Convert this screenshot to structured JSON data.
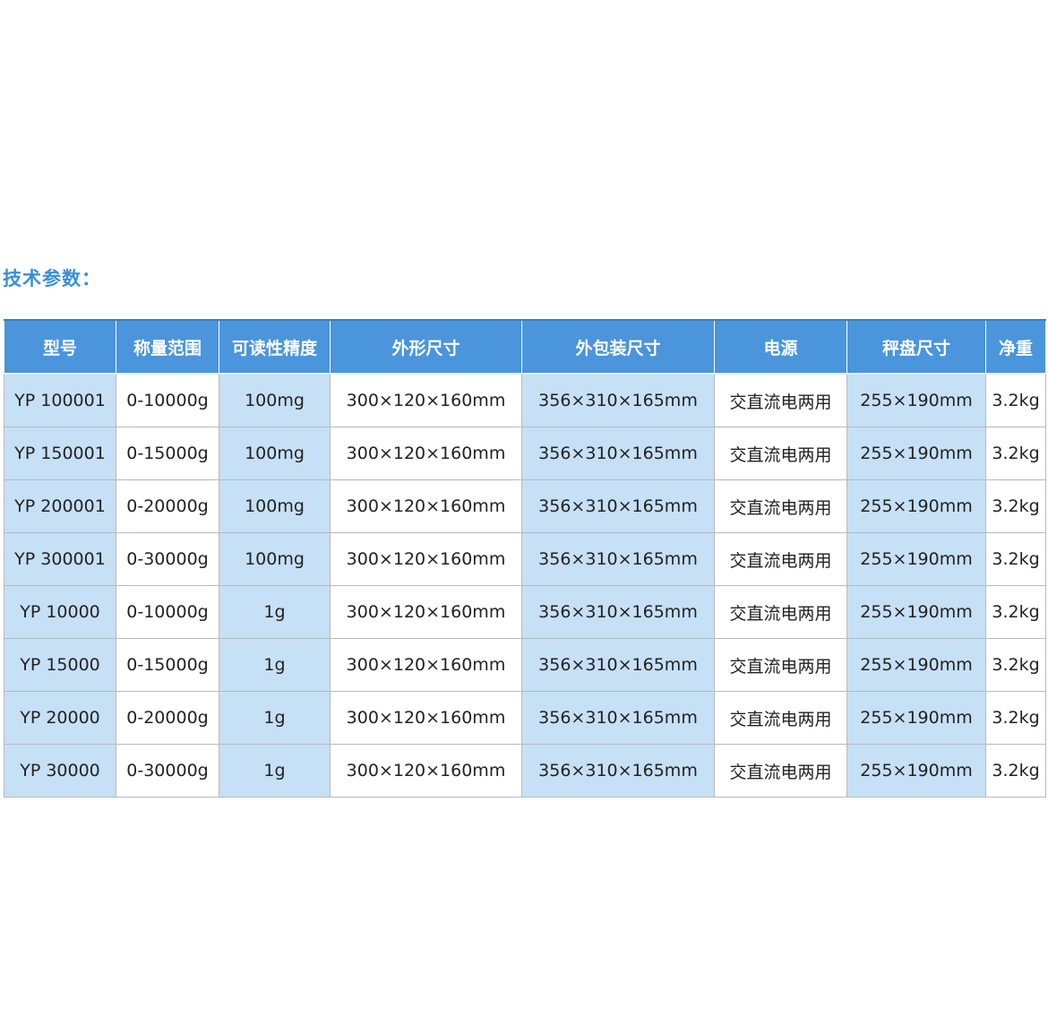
{
  "section_title": "技术参数：",
  "table": {
    "headers": [
      "型号",
      "称量范围",
      "可读性精度",
      "外形尺寸",
      "外包装尺寸",
      "电源",
      "秤盘尺寸",
      "净重"
    ],
    "rows": [
      [
        "YP 100001",
        "0-10000g",
        "100mg",
        "300×120×160mm",
        "356×310×165mm",
        "交直流电两用",
        "255×190mm",
        "3.2kg"
      ],
      [
        "YP 150001",
        "0-15000g",
        "100mg",
        "300×120×160mm",
        "356×310×165mm",
        "交直流电两用",
        "255×190mm",
        "3.2kg"
      ],
      [
        "YP 200001",
        "0-20000g",
        "100mg",
        "300×120×160mm",
        "356×310×165mm",
        "交直流电两用",
        "255×190mm",
        "3.2kg"
      ],
      [
        "YP 300001",
        "0-30000g",
        "100mg",
        "300×120×160mm",
        "356×310×165mm",
        "交直流电两用",
        "255×190mm",
        "3.2kg"
      ],
      [
        "YP 10000",
        "0-10000g",
        "1g",
        "300×120×160mm",
        "356×310×165mm",
        "交直流电两用",
        "255×190mm",
        "3.2kg"
      ],
      [
        "YP 15000",
        "0-15000g",
        "1g",
        "300×120×160mm",
        "356×310×165mm",
        "交直流电两用",
        "255×190mm",
        "3.2kg"
      ],
      [
        "YP 20000",
        "0-20000g",
        "1g",
        "300×120×160mm",
        "356×310×165mm",
        "交直流电两用",
        "255×190mm",
        "3.2kg"
      ],
      [
        "YP 30000",
        "0-30000g",
        "1g",
        "300×120×160mm",
        "356×310×165mm",
        "交直流电两用",
        "255×190mm",
        "3.2kg"
      ]
    ]
  },
  "colors": {
    "title": "#3a8fd8",
    "header_bg": "#4a95dc",
    "header_text": "#ffffff",
    "shaded_column": "#c6e0f6",
    "plain_column": "#ffffff"
  }
}
